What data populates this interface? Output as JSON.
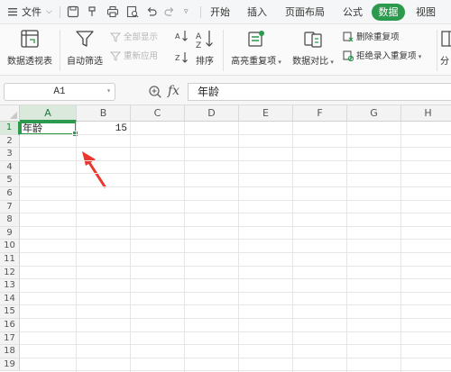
{
  "menubar": {
    "file_label": "文件",
    "tabs": [
      "开始",
      "插入",
      "页面布局",
      "公式",
      "数据",
      "视图"
    ],
    "active_tab": "数据"
  },
  "ribbon": {
    "pivot_table": "数据透视表",
    "auto_filter": "自动筛选",
    "show_all": "全部显示",
    "reapply": "重新应用",
    "sort": "排序",
    "highlight_duplicates": "高亮重复项",
    "compare_data": "数据对比",
    "remove_duplicates": "删除重复项",
    "reject_duplicate_entry": "拒绝录入重复项",
    "split_partial": "分"
  },
  "formula_bar": {
    "name_box": "A1",
    "fx": "fx",
    "formula": "年龄"
  },
  "sheet": {
    "columns": [
      "A",
      "B",
      "C",
      "D",
      "E",
      "F",
      "G",
      "H"
    ],
    "rows": [
      "1",
      "2",
      "3",
      "4",
      "5",
      "6",
      "7",
      "8",
      "9",
      "10",
      "11",
      "12",
      "13",
      "14",
      "15",
      "16",
      "17",
      "18",
      "19"
    ],
    "cells": {
      "A1": "年龄",
      "B1": "15"
    },
    "active_cell": "A1",
    "accent_color": "#2b9a4c",
    "annotation_arrow_color": "#e8382f"
  }
}
